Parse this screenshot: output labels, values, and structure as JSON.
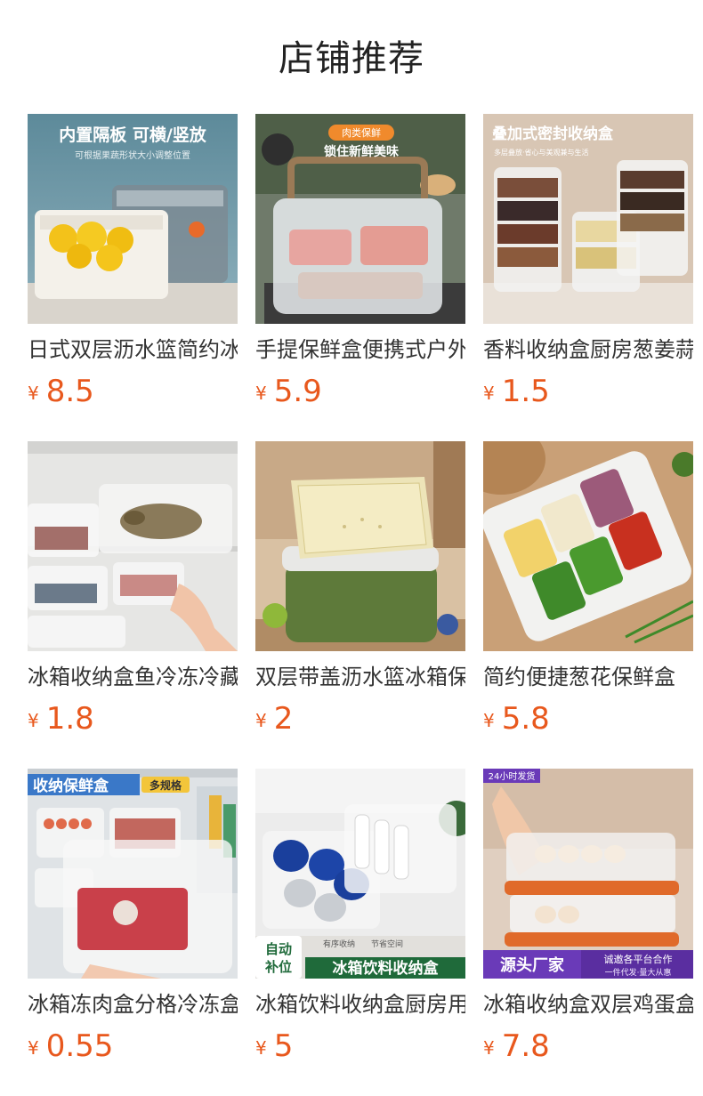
{
  "section_title": "店铺推荐",
  "products": [
    {
      "name": "日式双层沥水篮简约冰箱收纳盒",
      "currency": "¥",
      "price": "8.5",
      "overlay": {
        "headline": "内置隔板  可横/竖放",
        "subline": "可根据果蔬形状大小调整位置"
      }
    },
    {
      "name": "手提保鲜盒便携式户外野餐",
      "currency": "¥",
      "price": "5.9",
      "overlay": {
        "badge": "肉类保鲜",
        "headline": "锁住新鲜美味"
      }
    },
    {
      "name": "香料收纳盒厨房葱姜蒜",
      "currency": "¥",
      "price": "1.5",
      "overlay": {
        "headline": "叠加式密封收纳盒",
        "subline": "多层叠放·省心与美观兼与生活"
      }
    },
    {
      "name": "冰箱收纳盒鱼冷冻冷藏",
      "currency": "¥",
      "price": "1.8",
      "overlay": {}
    },
    {
      "name": "双层带盖沥水篮冰箱保鲜",
      "currency": "¥",
      "price": "2",
      "overlay": {}
    },
    {
      "name": "简约便捷葱花保鲜盒",
      "currency": "¥",
      "price": "5.8",
      "overlay": {}
    },
    {
      "name": "冰箱冻肉盒分格冷冻盒",
      "currency": "¥",
      "price": "0.55",
      "overlay": {
        "headline": "收纳保鲜盒",
        "badge": "多规格"
      }
    },
    {
      "name": "冰箱饮料收纳盒厨房用",
      "currency": "¥",
      "price": "5",
      "overlay": {
        "tag_line1": "有序收纳",
        "tag_line2": "节省空间",
        "badge_line1": "自动",
        "badge_line2": "补位",
        "banner": "冰箱饮料收纳盒"
      }
    },
    {
      "name": "冰箱收纳盒双层鸡蛋盒",
      "currency": "¥",
      "price": "7.8",
      "overlay": {
        "corner": "24小时发货",
        "banner": "源头厂家",
        "side_line1": "诚邀各平台合作",
        "side_line2": "一件代发·量大从惠"
      }
    }
  ],
  "colors": {
    "price": "#e8581d",
    "title": "#222222",
    "name": "#333333"
  }
}
